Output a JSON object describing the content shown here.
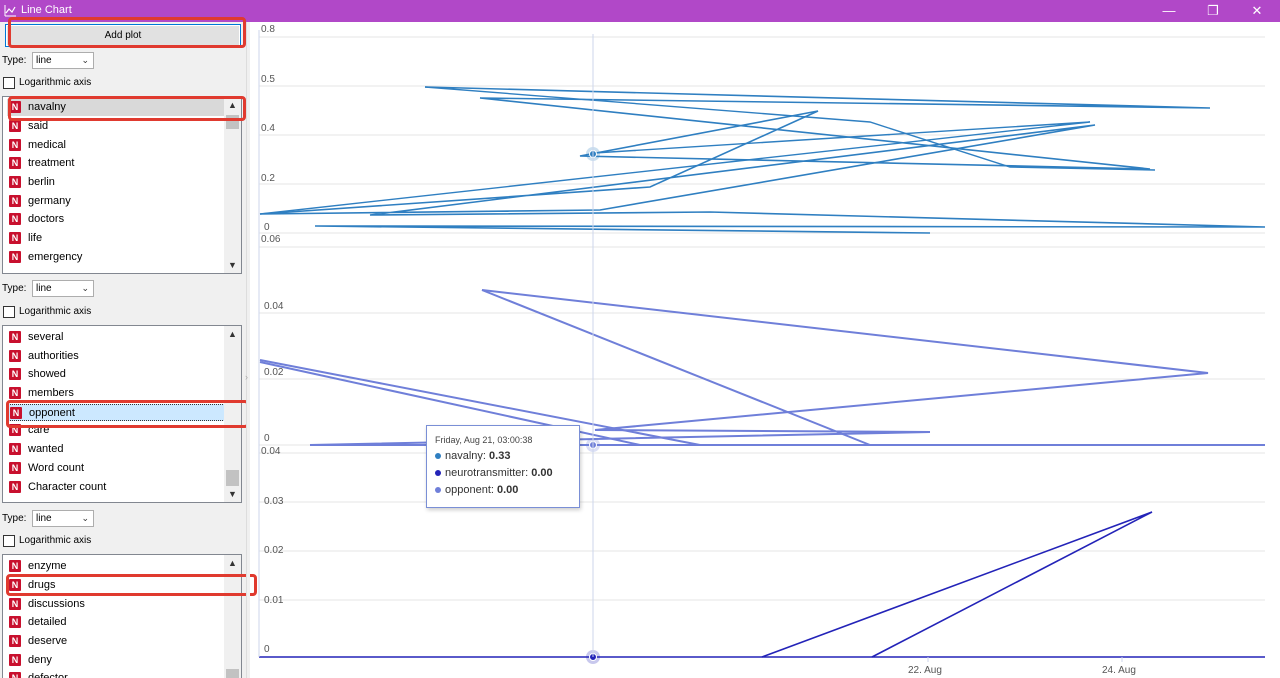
{
  "window": {
    "title": "Line Chart",
    "minimize": "—",
    "restore": "❐",
    "close": "✕"
  },
  "sidebar": {
    "add_plot_label": "Add plot",
    "panels": [
      {
        "type_label": "Type:",
        "type_value": "line",
        "log_label": "Logarithmic axis",
        "items": [
          "navalny",
          "said",
          "medical",
          "treatment",
          "berlin",
          "germany",
          "doctors",
          "life",
          "emergency"
        ],
        "selected": "navalny"
      },
      {
        "type_label": "Type:",
        "type_value": "line",
        "log_label": "Logarithmic axis",
        "items": [
          "several",
          "authorities",
          "showed",
          "members",
          "opponent",
          "care",
          "wanted",
          "Word count",
          "Character count"
        ],
        "selected": "opponent"
      },
      {
        "type_label": "Type:",
        "type_value": "line",
        "log_label": "Logarithmic axis",
        "items": [
          "enzyme",
          "drugs",
          "discussions",
          "detailed",
          "deserve",
          "deny",
          "defector"
        ],
        "selected": "drugs"
      }
    ]
  },
  "tooltip": {
    "header": "Friday, Aug 21, 03:00:38",
    "rows": [
      {
        "name": "navalny:",
        "value": "0.33",
        "color": "#2f7fc1"
      },
      {
        "name": "neurotransmitter:",
        "value": "0.00",
        "color": "#2323b8"
      },
      {
        "name": "opponent:",
        "value": "0.00",
        "color": "#6f7fd9"
      }
    ]
  },
  "chart_data": [
    {
      "type": "line",
      "series": [
        {
          "name": "navalny",
          "color": "#2f7fc1"
        }
      ],
      "yticks": [
        "0.8",
        "0.5",
        "0.4",
        "0.2",
        "0"
      ],
      "x_order": "unsorted",
      "points": [
        [
          0.4,
          0.585
        ],
        [
          0.8,
          0.565
        ],
        [
          0.75,
          0.75
        ],
        [
          0.7,
          0.715
        ],
        [
          0.4,
          0.58
        ],
        [
          0.5,
          0.245
        ],
        [
          0.0,
          0.07
        ],
        [
          0.0,
          0.215
        ],
        [
          0.3,
          0.08
        ],
        [
          0.5,
          0.3
        ]
      ]
    },
    {
      "type": "line",
      "series": [
        {
          "name": "opponent",
          "color": "#6f7fd9"
        }
      ],
      "yticks": [
        "0.06",
        "0.04",
        "0.02",
        "0"
      ],
      "x_order": "unsorted",
      "points": [
        [
          0.0,
          0.026
        ],
        [
          0.006,
          0.0
        ],
        [
          0.021,
          0.0215
        ],
        [
          0.009,
          0.017
        ]
      ]
    },
    {
      "type": "line",
      "series": [
        {
          "name": "neurotransmitter",
          "color": "#2323b8"
        }
      ],
      "yticks": [
        "0.04",
        "0.03",
        "0.02",
        "0.01",
        "0"
      ],
      "xticks": [
        "22. Aug",
        "24. Aug"
      ],
      "points": [
        [
          0.0,
          0.0
        ],
        [
          0.029,
          0.029
        ],
        [
          0.0,
          0.0
        ]
      ]
    }
  ],
  "highlight_color": "#e03a2f"
}
